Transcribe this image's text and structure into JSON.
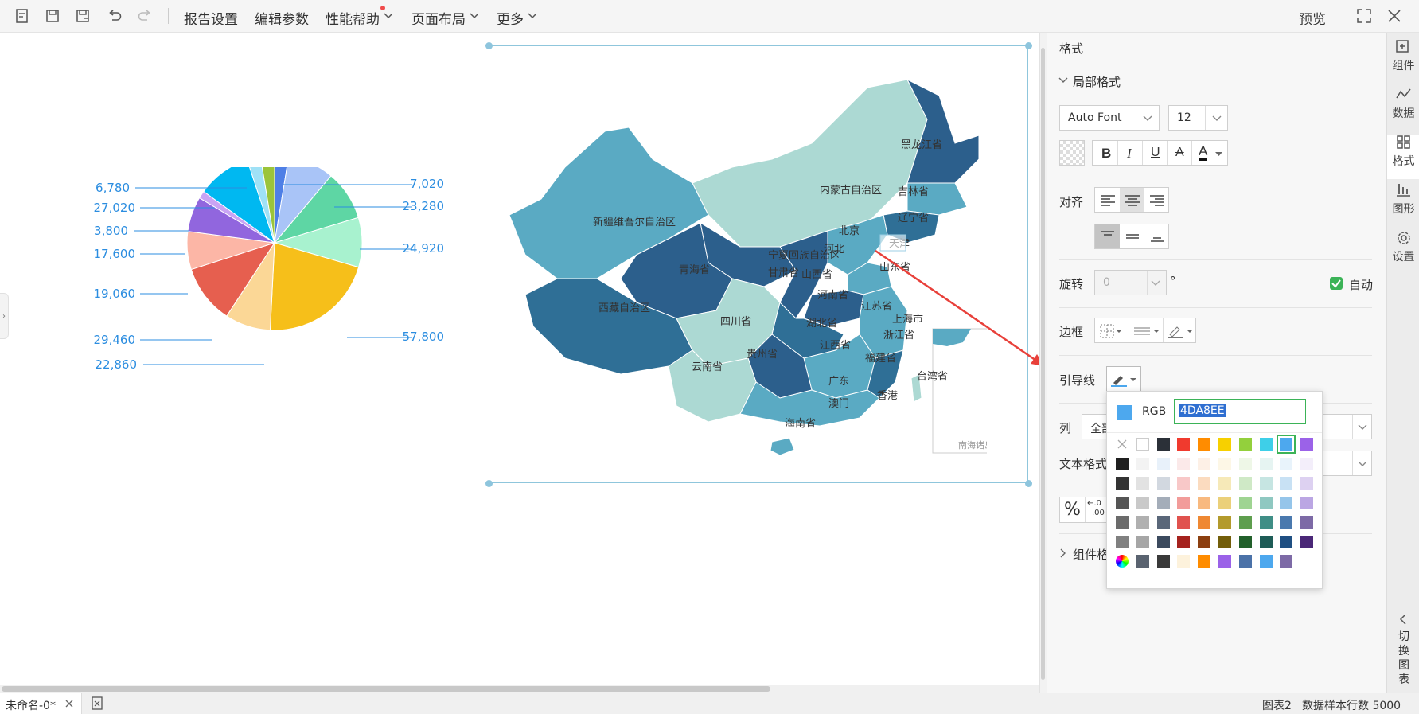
{
  "toolbar": {
    "icons": [
      "new-report-icon",
      "save-icon",
      "save-as-icon",
      "undo-icon",
      "redo-icon"
    ],
    "menus": {
      "report_settings": "报告设置",
      "edit_params": "编辑参数",
      "perf_help": "性能帮助",
      "page_layout": "页面布局",
      "more": "更多"
    },
    "preview": "预览"
  },
  "pie": {
    "labels": [
      "6,780",
      "27,020",
      "3,800",
      "17,600",
      "19,060",
      "29,460",
      "22,860",
      "7,020",
      "23,280",
      "24,920",
      "57,800"
    ],
    "slices": [
      {
        "value": 7020,
        "color": "#4e7fe6"
      },
      {
        "value": 23280,
        "color": "#a9c4f7"
      },
      {
        "value": 24920,
        "color": "#5ed6a4"
      },
      {
        "value": 24920,
        "color": "#a8f2cf"
      },
      {
        "value": 57800,
        "color": "#f6bf1a"
      },
      {
        "value": 22860,
        "color": "#fbd796"
      },
      {
        "value": 29460,
        "color": "#e65f4f"
      },
      {
        "value": 19060,
        "color": "#fcb6a6"
      },
      {
        "value": 17600,
        "color": "#9166de"
      },
      {
        "value": 3800,
        "color": "#c9a4f4"
      },
      {
        "value": 27020,
        "color": "#00b8f1"
      },
      {
        "value": 6780,
        "color": "#9fe1f6"
      },
      {
        "value": 7020,
        "color": "#9bc43a"
      }
    ],
    "label_color": "#2b8de0"
  },
  "map": {
    "regions": [
      "黑龙江省",
      "吉林省",
      "内蒙古自治区",
      "辽宁省",
      "新疆维吾尔自治区",
      "北京",
      "天津",
      "河北",
      "宁夏回族自治区",
      "青海省",
      "甘肃省",
      "山西省",
      "山东省",
      "河南省",
      "江苏省",
      "西藏自治区",
      "四川省",
      "湖北省",
      "上海市",
      "浙江省",
      "江西省",
      "贵州省",
      "福建省",
      "云南省",
      "广东",
      "台湾省",
      "香港",
      "澳门",
      "海南省"
    ],
    "inset_label": "南海诸岛"
  },
  "panel": {
    "title": "格式",
    "local_format": "局部格式",
    "font_name": "Auto Font",
    "font_size": "12",
    "align_label": "对齐",
    "rotate_label": "旋转",
    "rotate_value": "0",
    "degree": "°",
    "auto_label": "自动",
    "border_label": "边框",
    "leader_label": "引导线",
    "column_label": "列",
    "column_value": "全部",
    "text_format_label": "文本格式",
    "percent": "%",
    "decimal_top": "←.0",
    "decimal_bottom": ".00",
    "component_format": "组件格"
  },
  "color_picker": {
    "rgb_label": "RGB",
    "hex_value": "4DA8EE",
    "current_color": "#4DA8EE",
    "rows": [
      [
        "none",
        "#ffffff",
        "#2b3038",
        "#f03a2e",
        "#ff8c00",
        "#f7d000",
        "#93d03c",
        "#3ecfe8",
        "#4da8ee",
        "#9b62e8"
      ],
      [
        "#1f1f1f",
        "#f3f3f3",
        "#e8f1fa",
        "#fbe9e9",
        "#fdf0e6",
        "#fdf7e6",
        "#eef7e7",
        "#e6f4f2",
        "#e8f3fb",
        "#f3eefa"
      ],
      [
        "#333333",
        "#e2e2e2",
        "#d2d8e0",
        "#f8c8c8",
        "#fbdbbf",
        "#f6e9b8",
        "#cfe9c6",
        "#c6e5e2",
        "#c8e1f4",
        "#ddd1f1"
      ],
      [
        "#555555",
        "#c9c9c9",
        "#a4adb9",
        "#f29c9a",
        "#f8b97f",
        "#ebd07a",
        "#9fd492",
        "#8fc8c1",
        "#95c5ea",
        "#bba6e3"
      ],
      [
        "#6b6b6b",
        "#b0b0b0",
        "#5a6779",
        "#e0524e",
        "#ef8832",
        "#b39a2c",
        "#5e9e4e",
        "#3f8e86",
        "#4a79ae",
        "#7d6aa6"
      ],
      [
        "#808080",
        "#a6a6a6",
        "#3c4a5e",
        "#a5221e",
        "#8c3f10",
        "#735e0a",
        "#22602b",
        "#1e5c57",
        "#1f4f82",
        "#4a2777"
      ],
      [
        "wheel",
        "#5a6370",
        "#3a3a3a",
        "#fdf2dc",
        "#ff8c00",
        "#9b62e8",
        "#4b72a8",
        "#4da8ee",
        "#7d6aa6"
      ]
    ]
  },
  "rail": {
    "component": "组件",
    "data": "数据",
    "format": "格式",
    "graph": "图形",
    "settings": "设置",
    "switch_chart": "切换图表"
  },
  "status": {
    "tab_name": "未命名-0*",
    "chart_name": "图表2",
    "sample_rows": "数据样本行数 5000"
  }
}
